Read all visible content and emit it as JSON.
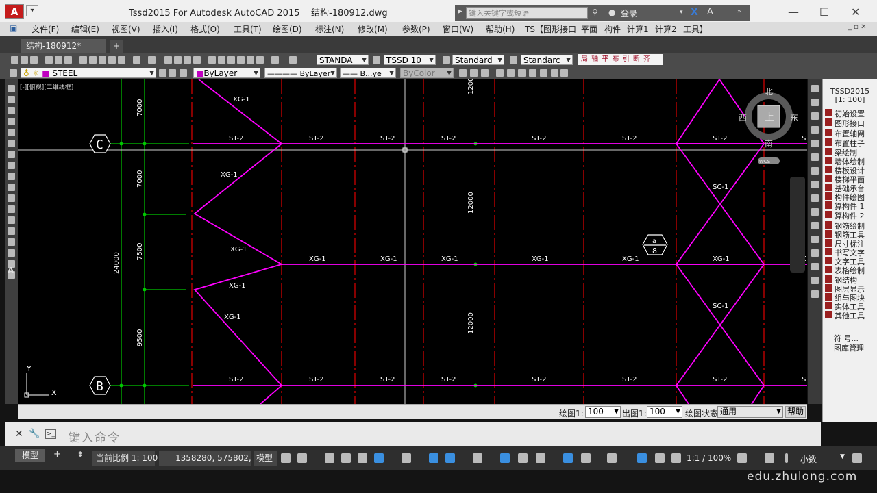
{
  "title": "Tssd2015 For Autodesk AutoCAD 2015    结构-180912.dwg",
  "search_placeholder": "键入关键字或短语",
  "login_label": "登录",
  "menu": [
    "文件(F)",
    "编辑(E)",
    "视图(V)",
    "插入(I)",
    "格式(O)",
    "工具(T)",
    "绘图(D)",
    "标注(N)",
    "修改(M)",
    "参数(P)",
    "窗口(W)",
    "帮助(H)",
    "TS【图形接口",
    "平面",
    "构件",
    "计算1",
    "计算2",
    "工具】"
  ],
  "doc_tab": "结构-180912*",
  "toolbar": {
    "text_style": "STANDA",
    "dim_style": "TSSD 10",
    "table_style": "Standard",
    "ml_style": "Standarc",
    "tssd_icons": "局 轴 平 布 引 断 齐",
    "layer": "STEEL",
    "color": "ByLayer",
    "linetype": "ByLayer",
    "lineweight": "B...ye",
    "plotstyle": "ByColor"
  },
  "viewport_label": "[-][俯视][二维线框]",
  "drawing": {
    "axes": [
      "C",
      "B"
    ],
    "dim_left": [
      "7000",
      "7000",
      "7500",
      "9500"
    ],
    "dim_total": "24000",
    "dim_mid": [
      "12000",
      "12000",
      "12000"
    ],
    "beams_top": [
      "ST-2",
      "ST-2",
      "ST-2",
      "ST-2",
      "ST-2",
      "ST-2",
      "ST-2"
    ],
    "beams_mid": [
      "XG-1",
      "XG-1",
      "XG-1",
      "XG-1",
      "XG-1",
      "XG-1"
    ],
    "beams_bottom": [
      "ST-2",
      "ST-2",
      "ST-2",
      "ST-2",
      "ST-2",
      "ST-2",
      "ST-2"
    ],
    "braces_left": [
      "XG-1",
      "XG-1",
      "XG-1",
      "XG-1",
      "XG-1"
    ],
    "braces_right": [
      "SC-1",
      "SC-1"
    ],
    "edge_top": "S",
    "edge_mid": "X",
    "edge_bottom": "S",
    "marker_top": "a",
    "marker_bottom": "8",
    "viewcube": {
      "north": "北",
      "south": "南",
      "east": "东",
      "west": "西",
      "face": "上",
      "wcs": "WCS"
    },
    "ucs": {
      "x": "X",
      "y": "Y"
    }
  },
  "tssd_panel": {
    "header": [
      "TSSD2015",
      "[1: 100]"
    ],
    "items": [
      "初始设置",
      "图形接口",
      "布置轴网",
      "布置柱子",
      "梁绘制",
      "墙体绘制",
      "楼板设计",
      "楼梯平面",
      "基础承台",
      "构件绘图",
      "算构件 1",
      "算构件 2",
      "钢筋绘制",
      "钢筋工具",
      "尺寸标注",
      "书写文字",
      "文字工具",
      "表格绘制",
      "钢结构",
      "图层显示",
      "组与图块",
      "实体工具",
      "其他工具"
    ],
    "footer": [
      "符 号...",
      "图库管理"
    ]
  },
  "scale_bar": {
    "draw_label": "绘图1:",
    "draw_value": "100",
    "plot_label": "出图1:",
    "plot_value": "100",
    "state_label": "绘图状态",
    "state_value": "通用",
    "help": "帮助"
  },
  "command_placeholder": "键入命令",
  "status": {
    "model_tab": "模型",
    "scale": "当前比例 1: 100",
    "coords": "1358280, 575802, 0",
    "model": "模型",
    "anno_scale": "1:1 / 100%",
    "units": "小数"
  },
  "watermark": "edu.zhulong.com",
  "colors": {
    "beam": "#ff00ff",
    "axis": "#ff0000",
    "grid": "#00c800",
    "cursor": "#ffffff"
  }
}
